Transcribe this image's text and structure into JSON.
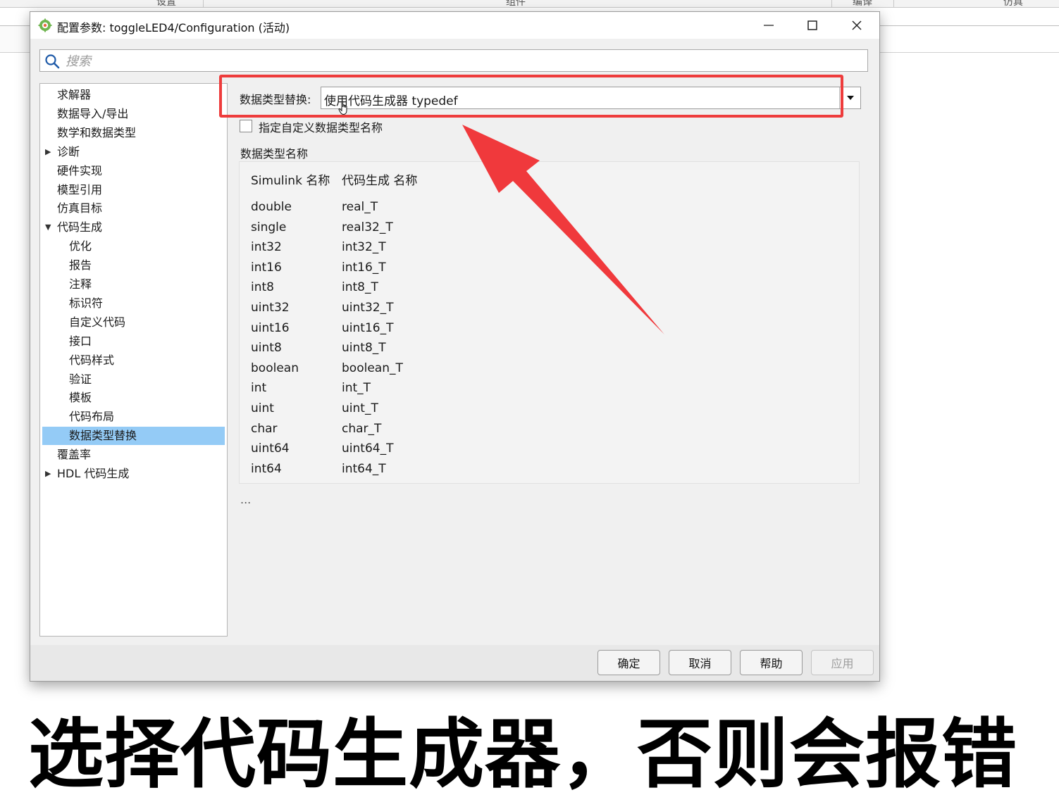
{
  "background_app": {
    "tabs": [
      "设置",
      "组件",
      "编译",
      "仿真"
    ]
  },
  "dialog": {
    "title": "配置参数: toggleLED4/Configuration (活动)",
    "search": {
      "placeholder": "搜索",
      "value": ""
    },
    "tree": [
      {
        "label": "求解器",
        "level": 0,
        "expander": ""
      },
      {
        "label": "数据导入/导出",
        "level": 0,
        "expander": ""
      },
      {
        "label": "数学和数据类型",
        "level": 0,
        "expander": ""
      },
      {
        "label": "诊断",
        "level": 0,
        "expander": "collapsed"
      },
      {
        "label": "硬件实现",
        "level": 0,
        "expander": ""
      },
      {
        "label": "模型引用",
        "level": 0,
        "expander": ""
      },
      {
        "label": "仿真目标",
        "level": 0,
        "expander": ""
      },
      {
        "label": "代码生成",
        "level": 0,
        "expander": "expanded"
      },
      {
        "label": "优化",
        "level": 1,
        "expander": ""
      },
      {
        "label": "报告",
        "level": 1,
        "expander": ""
      },
      {
        "label": "注释",
        "level": 1,
        "expander": ""
      },
      {
        "label": "标识符",
        "level": 1,
        "expander": ""
      },
      {
        "label": "自定义代码",
        "level": 1,
        "expander": ""
      },
      {
        "label": "接口",
        "level": 1,
        "expander": ""
      },
      {
        "label": "代码样式",
        "level": 1,
        "expander": ""
      },
      {
        "label": "验证",
        "level": 1,
        "expander": ""
      },
      {
        "label": "模板",
        "level": 1,
        "expander": ""
      },
      {
        "label": "代码布局",
        "level": 1,
        "expander": ""
      },
      {
        "label": "数据类型替换",
        "level": 1,
        "expander": "",
        "selected": true
      },
      {
        "label": "覆盖率",
        "level": 0,
        "expander": ""
      },
      {
        "label": "HDL 代码生成",
        "level": 0,
        "expander": "collapsed"
      }
    ],
    "replace_label": "数据类型替换:",
    "replace_value": "使用代码生成器 typedef",
    "custom_names_checkbox": {
      "label": "指定自定义数据类型名称",
      "checked": false
    },
    "names_section_label": "数据类型名称",
    "table": {
      "headers": [
        "Simulink 名称",
        "代码生成 名称"
      ],
      "rows": [
        [
          "double",
          "real_T"
        ],
        [
          "single",
          "real32_T"
        ],
        [
          "int32",
          "int32_T"
        ],
        [
          "int16",
          "int16_T"
        ],
        [
          "int8",
          "int8_T"
        ],
        [
          "uint32",
          "uint32_T"
        ],
        [
          "uint16",
          "uint16_T"
        ],
        [
          "uint8",
          "uint8_T"
        ],
        [
          "boolean",
          "boolean_T"
        ],
        [
          "int",
          "int_T"
        ],
        [
          "uint",
          "uint_T"
        ],
        [
          "char",
          "char_T"
        ],
        [
          "uint64",
          "uint64_T"
        ],
        [
          "int64",
          "int64_T"
        ]
      ]
    },
    "ellipsis": "...",
    "buttons": {
      "ok": "确定",
      "cancel": "取消",
      "help": "帮助",
      "apply": "应用"
    }
  },
  "caption": "选择代码生成器，否则会报错",
  "colors": {
    "highlight": "#ee3c3c",
    "selection": "#94cbf6",
    "arrow": "#f0393c"
  }
}
